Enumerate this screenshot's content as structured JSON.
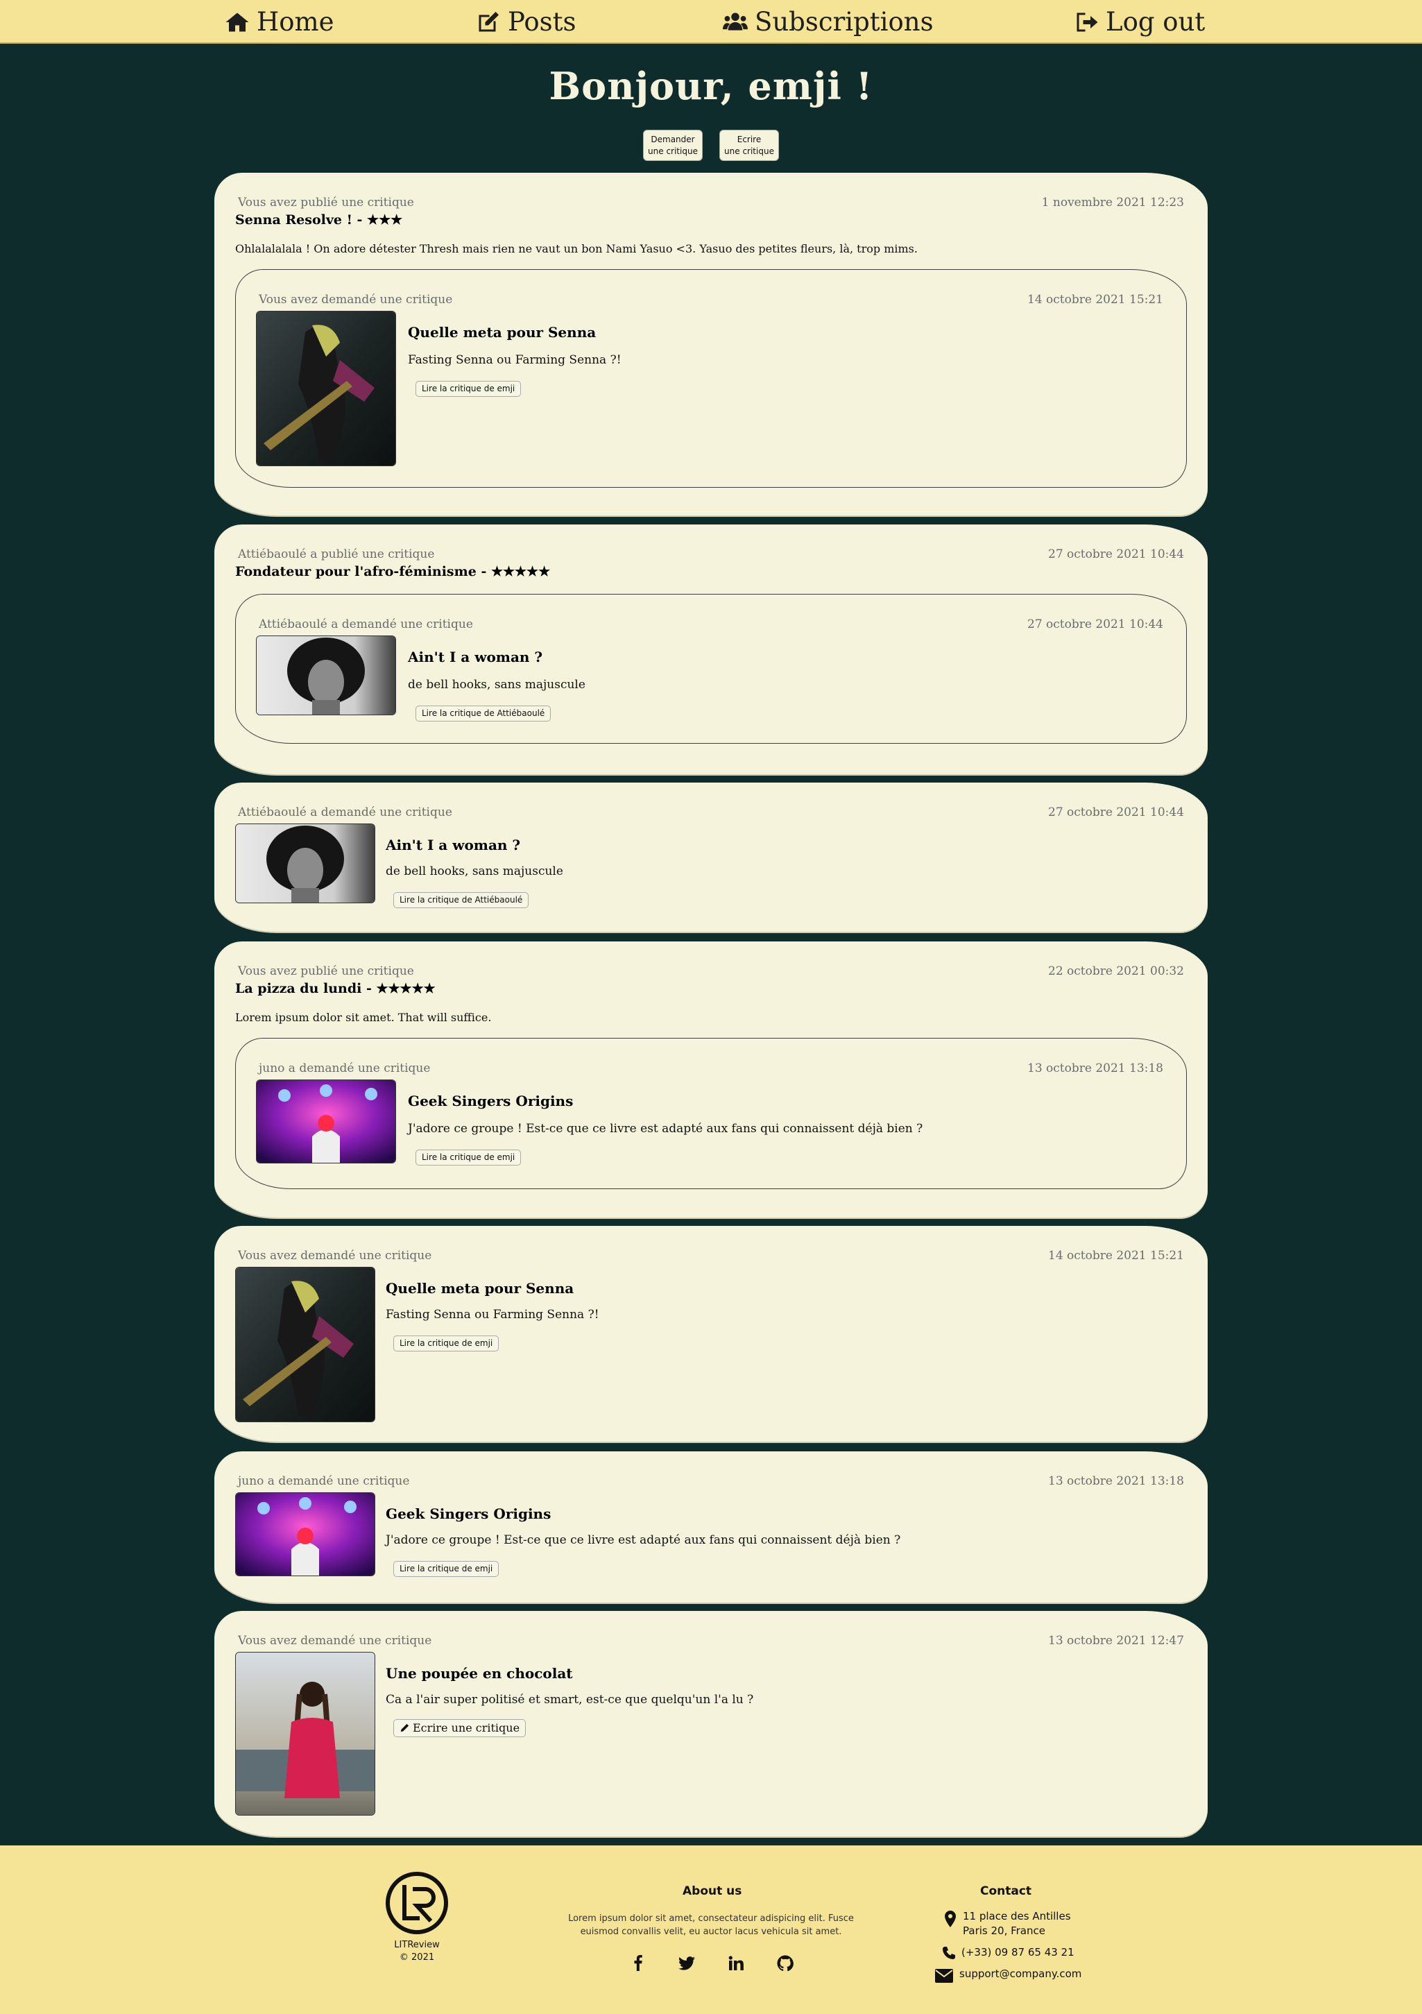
{
  "nav": {
    "home": "Home",
    "posts": "Posts",
    "subscriptions": "Subscriptions",
    "logout": "Log out"
  },
  "greeting": "Bonjour, emji !",
  "actions": {
    "request_line1": "Demander",
    "request_line2": "une critique",
    "write_line1": "Ecrire",
    "write_line2": "une critique"
  },
  "feed": {
    "p1": {
      "who": "Vous avez publié une critique",
      "date": "1 novembre 2021 12:23",
      "headline": "Senna Resolve ! -",
      "stars": "★★★",
      "body": "Ohlalalalala ! On adore détester Thresh mais rien ne vaut un bon Nami Yasuo <3. Yasuo des petites fleurs, là, trop mims.",
      "ticket": {
        "who": "Vous avez demandé une critique",
        "date": "14 octobre 2021 15:21",
        "title": "Quelle meta pour Senna",
        "desc": "Fasting Senna ou Farming Senna ?!",
        "button": "Lire la critique de emji"
      }
    },
    "p2": {
      "who": "Attiébaoulé a publié une critique",
      "date": "27 octobre 2021 10:44",
      "headline": "Fondateur pour l'afro-féminisme -",
      "stars": "★★★★★",
      "ticket": {
        "who": "Attiébaoulé a demandé une critique",
        "date": "27 octobre 2021 10:44",
        "title": "Ain't I a woman ?",
        "desc": "de bell hooks, sans majuscule",
        "button": "Lire la critique de Attiébaoulé"
      }
    },
    "p3": {
      "who": "Attiébaoulé a demandé une critique",
      "date": "27 octobre 2021 10:44",
      "title": "Ain't I a woman ?",
      "desc": "de bell hooks, sans majuscule",
      "button": "Lire la critique de Attiébaoulé"
    },
    "p4": {
      "who": "Vous avez publié une critique",
      "date": "22 octobre 2021 00:32",
      "headline": "La pizza du lundi -",
      "stars": "★★★★★",
      "body": "Lorem ipsum dolor sit amet. That will suffice.",
      "ticket": {
        "who": "juno a demandé une critique",
        "date": "13 octobre 2021 13:18",
        "title": "Geek Singers Origins",
        "desc": "J'adore ce groupe ! Est-ce que ce livre est adapté aux fans qui connaissent déjà bien ?",
        "button": "Lire la critique de emji"
      }
    },
    "p5": {
      "who": "Vous avez demandé une critique",
      "date": "14 octobre 2021 15:21",
      "title": "Quelle meta pour Senna",
      "desc": "Fasting Senna ou Farming Senna ?!",
      "button": "Lire la critique de emji"
    },
    "p6": {
      "who": "juno a demandé une critique",
      "date": "13 octobre 2021 13:18",
      "title": "Geek Singers Origins",
      "desc": "J'adore ce groupe ! Est-ce que ce livre est adapté aux fans qui connaissent déjà bien ?",
      "button": "Lire la critique de emji"
    },
    "p7": {
      "who": "Vous avez demandé une critique",
      "date": "13 octobre 2021 12:47",
      "title": "Une poupée en chocolat",
      "desc": "Ca a l'air super politisé et smart, est-ce que quelqu'un l'a lu ?",
      "button": "Ecrire une critique"
    }
  },
  "footer": {
    "brand": "LITReview",
    "copyright": "© 2021",
    "about_title": "About us",
    "about_line1": "Lorem ipsum dolor sit amet, consectateur adispicing elit. Fusce",
    "about_line2": "euismod convallis velit, eu auctor lacus vehicula sit amet.",
    "contact_title": "Contact",
    "address_line1": "11 place des Antilles",
    "address_line2": "Paris 20, France",
    "phone": "(+33) 09 87 65 43 21",
    "email": "support@company.com"
  },
  "colors": {
    "background": "#0f2c2c",
    "card": "#f5f3dc",
    "nav": "#f6e496"
  }
}
